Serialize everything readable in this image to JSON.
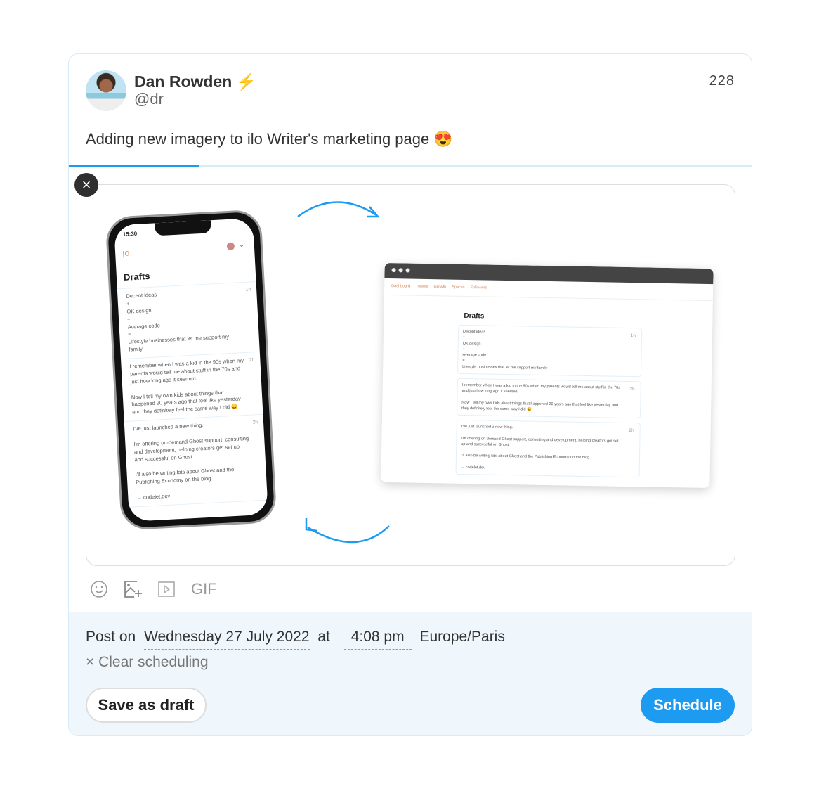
{
  "composer": {
    "author": {
      "name": "Dan Rowden",
      "badge_icon": "lightning-bolt",
      "handle": "@dr"
    },
    "char_count": "228",
    "text": "Adding new imagery to ilo Writer's marketing page 😍",
    "progress_fraction": 0.19,
    "accent_color": "#1d9bf0"
  },
  "media": {
    "remove_label": "×",
    "phone": {
      "time": "15:30",
      "logo": "ilo",
      "title": "Drafts",
      "items": [
        {
          "text": "Decent ideas\n+\nOK design\n+\nAverage code\n=\nLifestyle businesses that let me support my family",
          "age": "1h"
        },
        {
          "text": "I remember when I was a kid in the 90s when my parents would tell me about stuff in the 70s and just how long ago it seemed.\n\nNow I tell my own kids about things that happened 20 years ago that feel like yesterday and they definitely feel the same way I did 😄",
          "age": "2h"
        },
        {
          "text": "I've just launched a new thing.\n\nI'm offering on-demand Ghost support, consulting and development, helping creators get set up and successful on Ghost.\n\nI'll also be writing lots about Ghost and the Publishing Economy on the blog.\n\n→ codelet.dev",
          "age": "2h"
        }
      ]
    },
    "browser": {
      "nav": [
        "Dashboard",
        "Tweets",
        "Growth",
        "Spaces",
        "Followers"
      ],
      "title": "Drafts"
    }
  },
  "toolbar": {
    "gif_label": "GIF"
  },
  "schedule": {
    "prefix": "Post on",
    "date": "Wednesday 27 July 2022",
    "at": "at",
    "time": "4:08 pm",
    "timezone": "Europe/Paris",
    "clear_label": "× Clear scheduling",
    "save_draft_label": "Save as draft",
    "schedule_label": "Schedule"
  }
}
